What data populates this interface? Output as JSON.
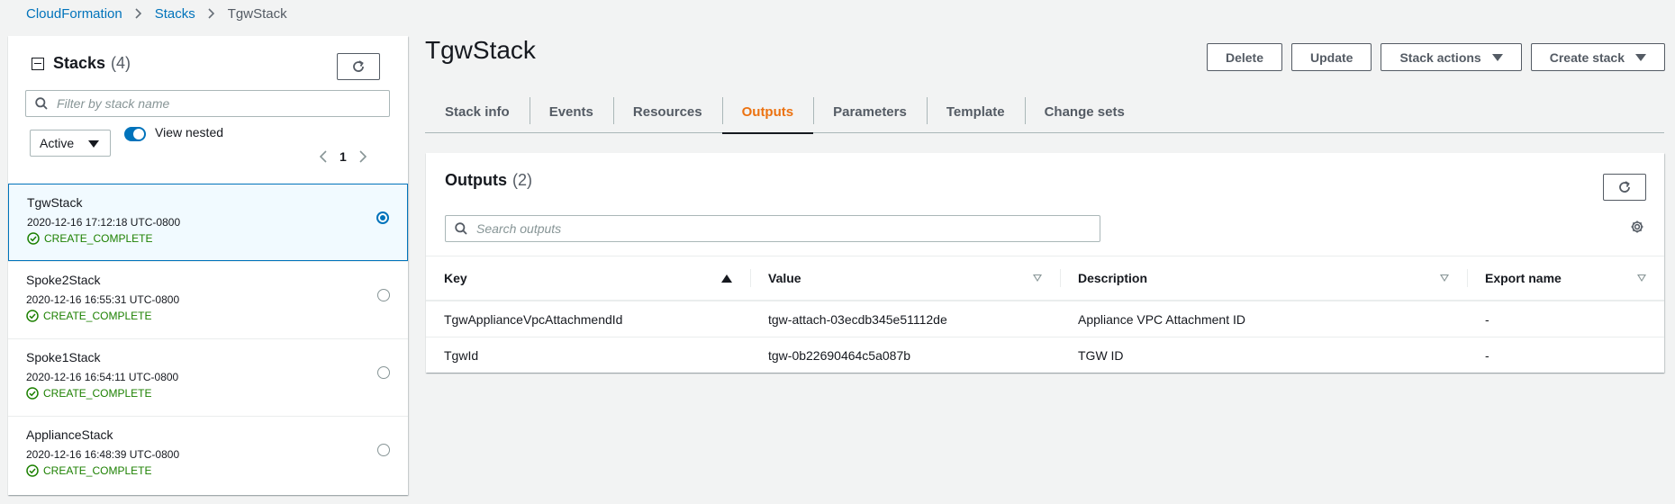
{
  "breadcrumb": {
    "items": [
      "CloudFormation",
      "Stacks"
    ],
    "current": "TgwStack"
  },
  "left_panel": {
    "title": "Stacks",
    "count": "(4)",
    "search_placeholder": "Filter by stack name",
    "status_filter": "Active",
    "view_nested_label": "View nested",
    "view_nested_on": true,
    "page": "1",
    "stacks": [
      {
        "name": "TgwStack",
        "date": "2020-12-16 17:12:18 UTC-0800",
        "status": "CREATE_COMPLETE",
        "selected": true
      },
      {
        "name": "Spoke2Stack",
        "date": "2020-12-16 16:55:31 UTC-0800",
        "status": "CREATE_COMPLETE",
        "selected": false
      },
      {
        "name": "Spoke1Stack",
        "date": "2020-12-16 16:54:11 UTC-0800",
        "status": "CREATE_COMPLETE",
        "selected": false
      },
      {
        "name": "ApplianceStack",
        "date": "2020-12-16 16:48:39 UTC-0800",
        "status": "CREATE_COMPLETE",
        "selected": false
      }
    ]
  },
  "main": {
    "title": "TgwStack",
    "actions": {
      "delete": "Delete",
      "update": "Update",
      "stack_actions": "Stack actions",
      "create_stack": "Create stack"
    },
    "tabs": [
      "Stack info",
      "Events",
      "Resources",
      "Outputs",
      "Parameters",
      "Template",
      "Change sets"
    ],
    "active_tab": "Outputs",
    "outputs": {
      "title": "Outputs",
      "count": "(2)",
      "search_placeholder": "Search outputs",
      "columns": [
        "Key",
        "Value",
        "Description",
        "Export name"
      ],
      "rows": [
        [
          "TgwApplianceVpcAttachmendId",
          "tgw-attach-03ecdb345e51112de",
          "Appliance VPC Attachment ID",
          "-"
        ],
        [
          "TgwId",
          "tgw-0b22690464c5a087b",
          "TGW ID",
          "-"
        ]
      ]
    }
  },
  "colors": {
    "link": "#0073bb",
    "active_tab": "#ec7211",
    "success": "#1d8102",
    "selected_bg": "#f1faff"
  }
}
